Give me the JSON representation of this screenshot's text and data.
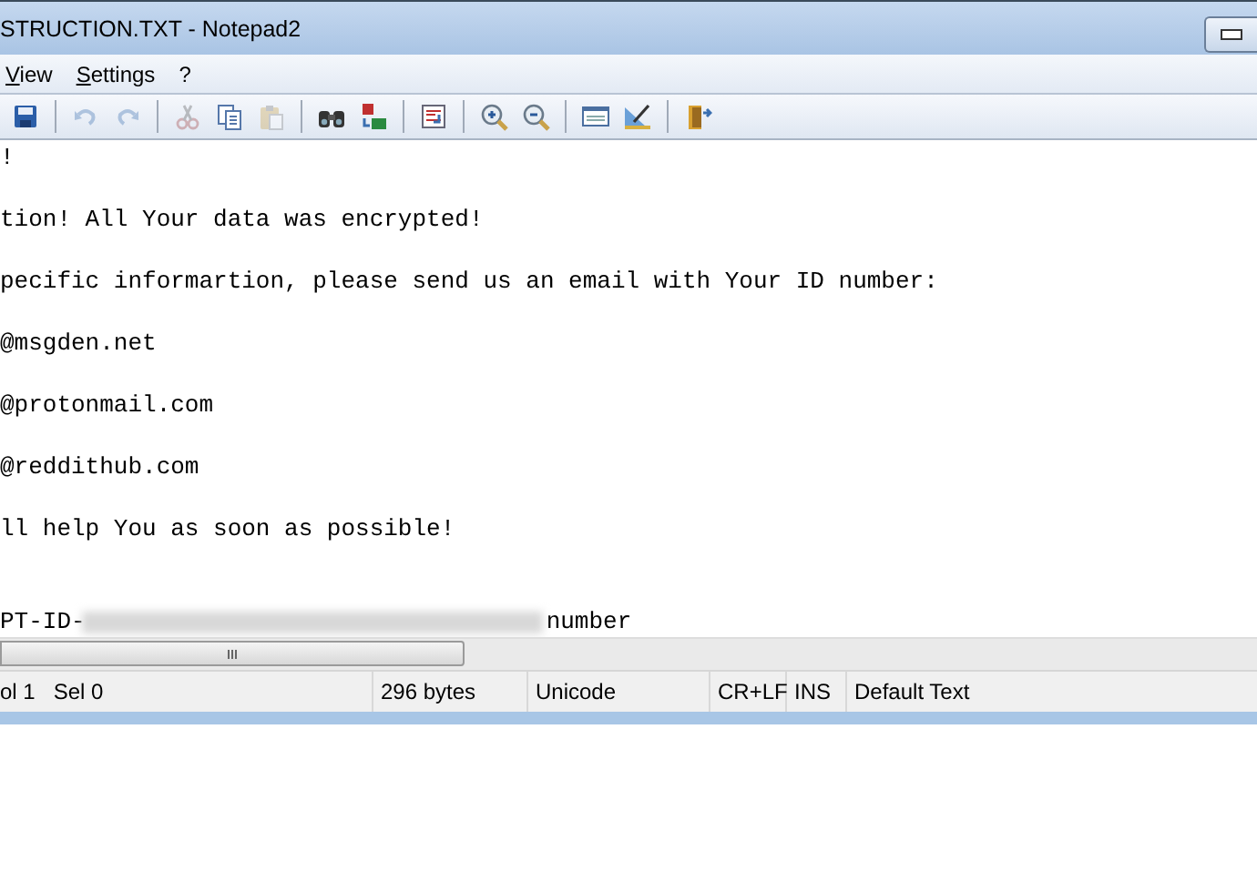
{
  "window": {
    "title": "STRUCTION.TXT - Notepad2"
  },
  "menu": [
    {
      "label": "View"
    },
    {
      "label": "Settings"
    },
    {
      "label": "?"
    }
  ],
  "toolbar": [
    {
      "kind": "save",
      "disabled": false
    },
    {
      "kind": "sep"
    },
    {
      "kind": "undo",
      "disabled": true
    },
    {
      "kind": "redo",
      "disabled": true
    },
    {
      "kind": "sep"
    },
    {
      "kind": "cut",
      "disabled": true
    },
    {
      "kind": "copy",
      "disabled": false
    },
    {
      "kind": "paste",
      "disabled": true
    },
    {
      "kind": "sep"
    },
    {
      "kind": "find",
      "disabled": false
    },
    {
      "kind": "replace",
      "disabled": false
    },
    {
      "kind": "sep"
    },
    {
      "kind": "wrap",
      "disabled": false
    },
    {
      "kind": "sep"
    },
    {
      "kind": "zoomin",
      "disabled": false
    },
    {
      "kind": "zoomout",
      "disabled": false
    },
    {
      "kind": "sep"
    },
    {
      "kind": "scheme",
      "disabled": false
    },
    {
      "kind": "customize",
      "disabled": false
    },
    {
      "kind": "sep"
    },
    {
      "kind": "exit",
      "disabled": false
    }
  ],
  "editor": {
    "lines": [
      {
        "kind": "text",
        "text": "!"
      },
      {
        "kind": "blank"
      },
      {
        "kind": "text",
        "text": "tion! All Your data was encrypted!"
      },
      {
        "kind": "blank"
      },
      {
        "kind": "text",
        "text": "pecific informartion, please send us an email with Your ID number:"
      },
      {
        "kind": "blank"
      },
      {
        "kind": "text",
        "text": "@msgden.net"
      },
      {
        "kind": "blank"
      },
      {
        "kind": "text",
        "text": "@protonmail.com"
      },
      {
        "kind": "blank"
      },
      {
        "kind": "text",
        "text": "@reddithub.com"
      },
      {
        "kind": "blank"
      },
      {
        "kind": "text",
        "text": "ll help You as soon as possible!"
      },
      {
        "kind": "blank"
      },
      {
        "kind": "blank"
      },
      {
        "kind": "text",
        "text": "PT-ID-",
        "redacted": true,
        "after": "number"
      }
    ]
  },
  "status_bar": [
    "ol 1",
    "Sel 0",
    "296 bytes",
    "Unicode",
    "CR+LF",
    "INS",
    "Default Text"
  ]
}
